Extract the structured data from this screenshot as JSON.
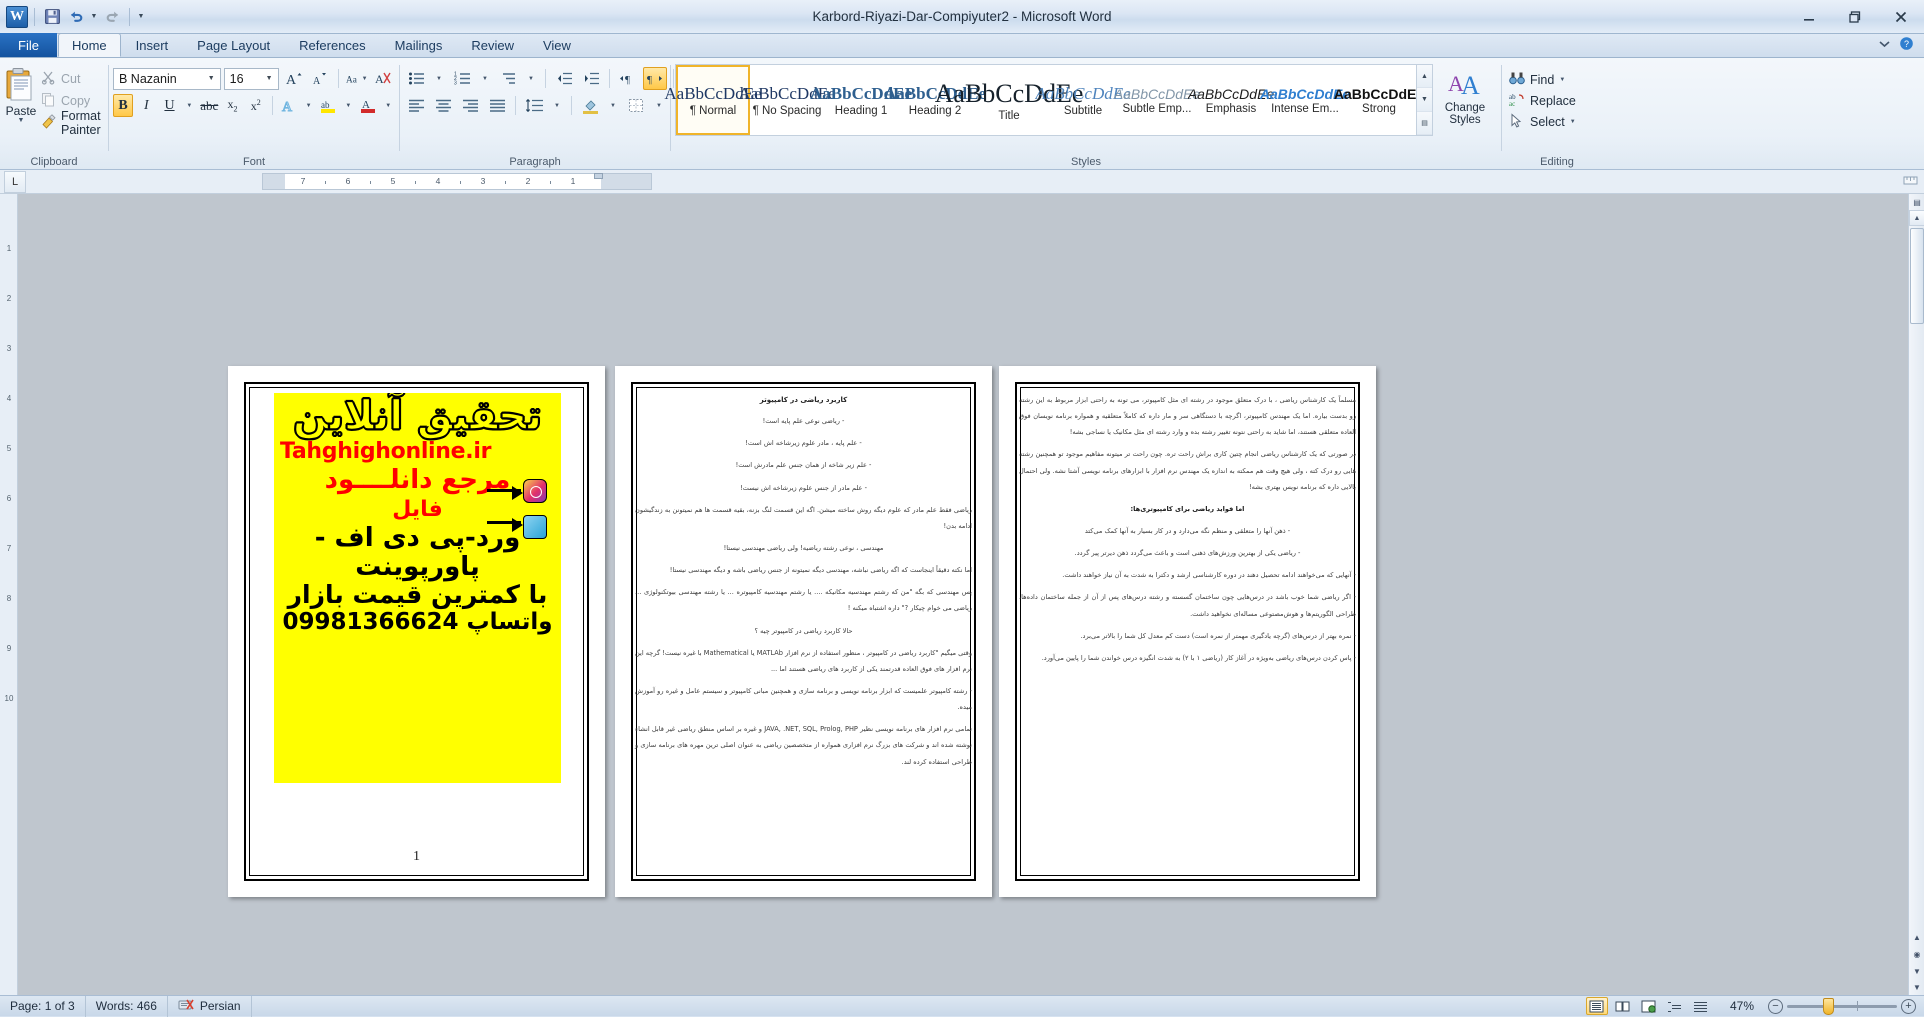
{
  "titlebar": {
    "document_title": "Karbord-Riyazi-Dar-Compiyuter2  -  Microsoft Word",
    "app_logo": "word-logo",
    "quick_access": [
      {
        "name": "save-icon",
        "label": "Save"
      },
      {
        "name": "undo-icon",
        "label": "Undo"
      },
      {
        "name": "redo-icon",
        "label": "Redo"
      },
      {
        "name": "customize-qat-icon",
        "label": "Customize Quick Access Toolbar"
      }
    ],
    "window_controls": [
      {
        "name": "minimize-button",
        "glyph": "–"
      },
      {
        "name": "restore-button",
        "glyph": "❐"
      },
      {
        "name": "close-button",
        "glyph": "✕"
      }
    ]
  },
  "tabs": [
    {
      "label": "File",
      "active": false
    },
    {
      "label": "Home",
      "active": true
    },
    {
      "label": "Insert",
      "active": false
    },
    {
      "label": "Page Layout",
      "active": false
    },
    {
      "label": "References",
      "active": false
    },
    {
      "label": "Mailings",
      "active": false
    },
    {
      "label": "Review",
      "active": false
    },
    {
      "label": "View",
      "active": false
    }
  ],
  "ribbon": {
    "clipboard": {
      "group_label": "Clipboard",
      "paste_label": "Paste",
      "items": [
        {
          "label": "Cut",
          "icon": "scissors-icon",
          "enabled": false
        },
        {
          "label": "Copy",
          "icon": "copy-icon",
          "enabled": false
        },
        {
          "label": "Format Painter",
          "icon": "format-painter-icon",
          "enabled": true
        }
      ]
    },
    "font": {
      "group_label": "Font",
      "font_name": "B Nazanin",
      "font_size": "16",
      "buttons_row1": [
        "grow-font-icon",
        "shrink-font-icon",
        "change-case-icon",
        "clear-formatting-icon"
      ],
      "buttons_row2": [
        "bold-icon",
        "italic-icon",
        "underline-icon",
        "strikethrough-icon",
        "subscript-icon",
        "superscript-icon",
        "text-effects-icon",
        "text-highlight-icon",
        "font-color-icon"
      ],
      "bold_active": true
    },
    "paragraph": {
      "group_label": "Paragraph",
      "buttons_row1": [
        "bullets-icon",
        "numbering-icon",
        "multilevel-list-icon",
        "decrease-indent-icon",
        "increase-indent-icon",
        "ltr-text-icon",
        "rtl-text-icon",
        "sort-icon",
        "show-formatting-marks-icon"
      ],
      "buttons_row2": [
        "align-left-icon",
        "align-center-icon",
        "align-right-icon",
        "justify-icon",
        "line-spacing-icon",
        "shading-icon",
        "borders-icon"
      ],
      "rtl_active": true
    },
    "styles": {
      "group_label": "Styles",
      "gallery": [
        {
          "preview": "AaBbCcDdEe",
          "name": "¶ Normal",
          "selected": true
        },
        {
          "preview": "AaBbCcDdEe",
          "name": "¶ No Spacing",
          "selected": false
        },
        {
          "preview": "AaBbCcDdEe",
          "name": "Heading 1",
          "selected": false
        },
        {
          "preview": "AaBbCcDdEe",
          "name": "Heading 2",
          "selected": false
        },
        {
          "preview": "AaBbCcDdEe",
          "name": "Title",
          "selected": false
        },
        {
          "preview": "AaBbCcDdEe",
          "name": "Subtitle",
          "selected": false
        },
        {
          "preview": "AaBbCcDdEe",
          "name": "Subtle Emp...",
          "selected": false
        },
        {
          "preview": "AaBbCcDdEe",
          "name": "Emphasis",
          "selected": false
        },
        {
          "preview": "AaBbCcDdEe",
          "name": "Intense Em...",
          "selected": false
        },
        {
          "preview": "AaBbCcDdEe",
          "name": "Strong",
          "selected": false
        }
      ],
      "change_styles_label_line1": "Change",
      "change_styles_label_line2": "Styles"
    },
    "editing": {
      "group_label": "Editing",
      "items": [
        {
          "label": "Find",
          "icon": "binoculars-icon",
          "has_caret": true
        },
        {
          "label": "Replace",
          "icon": "replace-icon",
          "has_caret": false
        },
        {
          "label": "Select",
          "icon": "select-pointer-icon",
          "has_caret": true
        }
      ]
    }
  },
  "ruler": {
    "tab_selector": "L",
    "labels": [
      "7",
      "6",
      "5",
      "4",
      "3",
      "2",
      "1"
    ],
    "vertical_labels": [
      "1",
      "2",
      "3",
      "4",
      "5",
      "6",
      "7",
      "8",
      "9",
      "10"
    ]
  },
  "document": {
    "page1": {
      "ad": {
        "line1": "تحقیق آنلاین",
        "line2": "Tahghighonline.ir",
        "line3": "مرجع دانلــــود",
        "line4": "فایل",
        "line5": "ورد-پی دی اف - پاورپوینت",
        "line6": "با کمترین قیمت بازار",
        "line7": "واتساپ 09981366624",
        "instagram_icon": "instagram-icon",
        "telegram_icon": "telegram-icon",
        "background_color": "#ffff00",
        "text_color_red": "#ff0000"
      },
      "page_number": "1"
    },
    "page2": {
      "heading": "کاربرد ریاضی در کامپیوتر",
      "paragraphs": [
        "- ریاضی نوعی علم پایه است!",
        "- علم پایه ، مادر علوم زیرشاخه اش است!",
        "- علم زیر شاخه از همان جنس علم مادرش است!",
        "- علم مادر از جنس علوم زیرشاخه اش نیست!",
        "ریاضی فقط علم مادر که علوم دیگه روش ساخته میشن. اگه این قسمت لنگ بزنه، بقیه قسمت ها هم نمیتونن به زندگیشون ادامه بدن!",
        "مهندسی ، نوعی رشته ریاضیه! ولی ریاضی مهندسی نیستا!",
        "اما نکته دقیقاً اینجاست که اگه ریاضی نباشه، مهندسی دیگه نمیتونه از جنس ریاضی باشه و دیگه مهندسی نیستا!",
        "پس مهندسی که بگه \"من که رشتم مهندسیه مکانیکه .... یا رشتم مهندسیه کامپیوتره ... یا رشته مهندسی بیوتکنولوژی ... ریاضی می خوام چیکار ?\" داره اشتباه میکنه !",
        "حالا کاربرد ریاضی در کامپیوتر چیه ؟",
        "وقتی میگیم \"کاربرد ریاضی در کامپیوتر ، منظور استفاده از نرم افزار MATLAb یا Mathematical با غیره نیست! گرچه این نرم افزار های فوق العاده قدرتمند یکی از کاربرد های ریاضی هستند اما ...",
        "- رشته کامپیوتر علمیست که ابزار برنامه نویسی و برنامه سازی و همچنین مبانی کامپیوتر و سیستم عامل و غیره رو آموزش میده.",
        "تمامی نرم افزار های برنامه نویسی نظیر JAVA, .NET, SQL, Prolog, PHP و غیره بر اساس منطق ریاضی غیر قابل انشاء نوشته شده اند و شرکت های بزرگ نرم افزاری همواره از متخصصین ریاضی به عنوان اصلی ترین مهره های برنامه سازی و طراحی استفاده کرده لند."
      ]
    },
    "page3": {
      "paragraphs": [
        "مسلماً یک کارشناس ریاضی ، با درک متعلق موجود در رشته ای مثل کامپیوتر، می تونه به راحتی ابزار مربوط به این رشته رو بدست بیاره. اما یک مهندس کامپیوتر، اگرچه با دستگاهی سر و مار داره که کاملاً متعلقیه و همواره برنامه نویسان فوق العاده متعلقی هستند، اما شاید به راحتی نتونه تغییر رشته بده و وارد رشته ای مثل مکانیک یا نساجی بشه!",
        "در صورتی که یک کارشناس ریاضی انجام چتین کاری براش راحت تره. چون راحت تر میتونه مفاهیم موجود تو همچنین رشته هایی رو درک کته ، ولی هیچ وقت هم ممکته به اندازه یک مهندس نرم افزار با ابزارهای برنامه نویسی آشتا نشه. ولی احتمال بالایی داره که برنامه نویس بهتری بشه!"
      ],
      "subheading": "اما فواید ریاضی برای کامپیوتری‌ها:",
      "bullets": [
        "- ذهن آنها را متعلقی و منظم نگه می‌دارد و در کار بسیار به آنها کمک می‌کتد",
        "- ریاضی یکی از بهترین ورزش‌های ذهنی است و باعث می‌گردد ذهن دیرتر پیر گردد.",
        "- آنهایی که می‌خواهند ادامه تحصیل دهند در دوره کارشناسی ارشد و دکترا به شدت به آن نیاز خواهند داشت.",
        "- اگر ریاضی شما خوب باشد در درس‌هایی چون ساختمان گسسته و رشته درس‌های پس از آن از جمله ساختمان داده‌ها، طراحی الگوریتم‌ها و هوش‌مصتوعی مساله‌ای نخواهید داشت.",
        "- نمره بهتر از درس‌های (گرچه یادگیری مهمتر از نمره است) دست کم معدل کل شما را بالاتر می‌برد.",
        "- پاس کردن درس‌های ریاضی به‌ویژه در آغاز کار (ریاضی ۱ با ۲) به شدت انگیزه درس خواندن شما را پایین می‌آورد."
      ]
    }
  },
  "statusbar": {
    "page_info": "Page: 1 of 3",
    "word_count": "Words: 466",
    "proofing_icon": "spelling-check-icon",
    "language": "Persian",
    "views": [
      {
        "name": "print-layout-view-button",
        "active": true
      },
      {
        "name": "full-screen-reading-view-button",
        "active": false
      },
      {
        "name": "web-layout-view-button",
        "active": false
      },
      {
        "name": "outline-view-button",
        "active": false
      },
      {
        "name": "draft-view-button",
        "active": false
      }
    ],
    "zoom_level": "47%",
    "zoom_out_label": "−",
    "zoom_in_label": "+"
  }
}
